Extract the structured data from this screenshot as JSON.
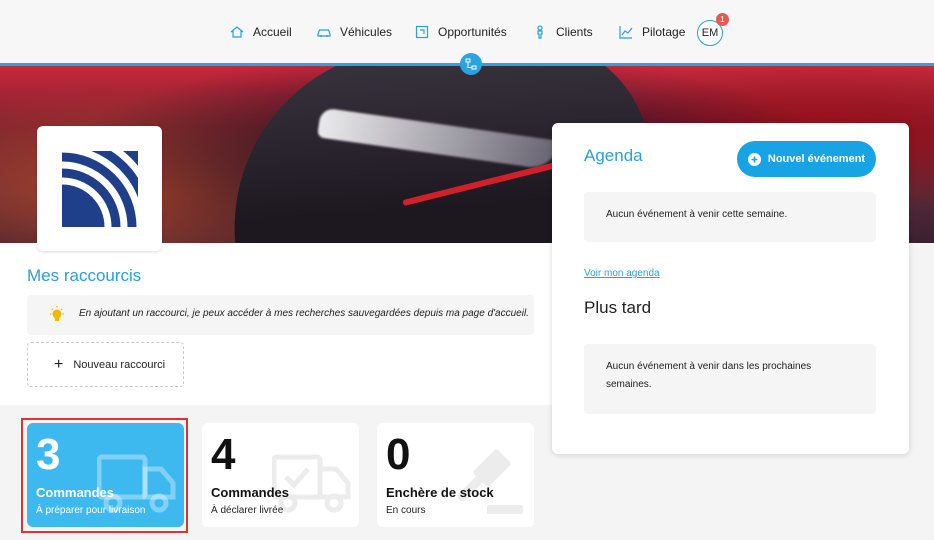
{
  "nav": {
    "items": [
      {
        "label": "Accueil",
        "icon": "home-icon"
      },
      {
        "label": "Véhicules",
        "icon": "car-icon"
      },
      {
        "label": "Opportunités",
        "icon": "opportunity-icon"
      },
      {
        "label": "Clients",
        "icon": "person-icon"
      },
      {
        "label": "Pilotage",
        "icon": "chart-icon"
      }
    ],
    "avatar_initials": "EM",
    "notification_count": "1"
  },
  "shortcuts": {
    "title": "Mes raccourcis",
    "tip": "En ajoutant un raccourci, je peux accéder à mes recherches sauvegardées depuis ma page d'accueil.",
    "new_label": "Nouveau raccourci"
  },
  "stats": [
    {
      "number": "3",
      "title": "Commandes",
      "subtitle": "À préparer pour livraison",
      "icon": "truck-icon"
    },
    {
      "number": "4",
      "title": "Commandes",
      "subtitle": "À déclarer livrée",
      "icon": "truck-check-icon"
    },
    {
      "number": "0",
      "title": "Enchère de stock",
      "subtitle": "En cours",
      "icon": "gavel-icon"
    }
  ],
  "agenda": {
    "title": "Agenda",
    "new_event_label": "Nouvel événement",
    "empty_week": "Aucun événement à venir cette semaine.",
    "view_link": "Voir mon agenda",
    "later_title": "Plus tard",
    "empty_later": "Aucun événement à venir dans les prochaines semaines."
  },
  "colors": {
    "accent": "#2aa3e0",
    "active_card": "#3db9ef",
    "highlight": "#e2312f",
    "badge": "#e5594f",
    "logo_blue": "#1f3f8a"
  }
}
